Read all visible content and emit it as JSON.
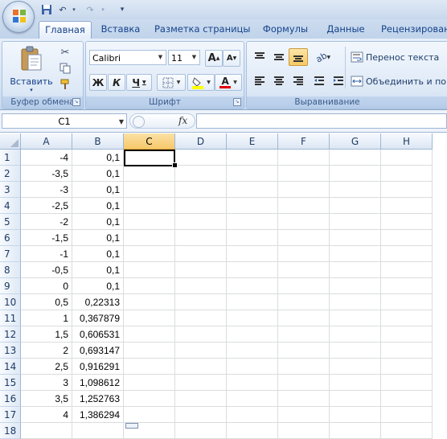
{
  "tabs": [
    "Главная",
    "Вставка",
    "Разметка страницы",
    "Формулы",
    "Данные",
    "Рецензирование"
  ],
  "active_tab": "Главная",
  "clipboard": {
    "paste_label": "Вставить",
    "group_label": "Буфер обмена"
  },
  "font": {
    "family": "Calibri",
    "size": "11",
    "group_label": "Шрифт",
    "bold": "Ж",
    "italic": "К",
    "underline": "Ч",
    "grow": "A",
    "shrink": "A",
    "font_color_glyph": "A"
  },
  "alignment": {
    "wrap_text": "Перенос текста",
    "merge_center": "Объединить и пом",
    "group_label": "Выравнивание"
  },
  "formula_bar": {
    "name_box": "C1",
    "fx": "fx",
    "formula": ""
  },
  "columns": [
    "A",
    "B",
    "C",
    "D",
    "E",
    "F",
    "G",
    "H"
  ],
  "selected_column": "C",
  "rows": [
    {
      "n": "1",
      "a": "-4",
      "b": "0,1"
    },
    {
      "n": "2",
      "a": "-3,5",
      "b": "0,1"
    },
    {
      "n": "3",
      "a": "-3",
      "b": "0,1"
    },
    {
      "n": "4",
      "a": "-2,5",
      "b": "0,1"
    },
    {
      "n": "5",
      "a": "-2",
      "b": "0,1"
    },
    {
      "n": "6",
      "a": "-1,5",
      "b": "0,1"
    },
    {
      "n": "7",
      "a": "-1",
      "b": "0,1"
    },
    {
      "n": "8",
      "a": "-0,5",
      "b": "0,1"
    },
    {
      "n": "9",
      "a": "0",
      "b": "0,1"
    },
    {
      "n": "10",
      "a": "0,5",
      "b": "0,22313"
    },
    {
      "n": "11",
      "a": "1",
      "b": "0,367879"
    },
    {
      "n": "12",
      "a": "1,5",
      "b": "0,606531"
    },
    {
      "n": "13",
      "a": "2",
      "b": "0,693147"
    },
    {
      "n": "14",
      "a": "2,5",
      "b": "0,916291"
    },
    {
      "n": "15",
      "a": "3",
      "b": "1,098612"
    },
    {
      "n": "16",
      "a": "3,5",
      "b": "1,252763"
    },
    {
      "n": "17",
      "a": "4",
      "b": "1,386294"
    },
    {
      "n": "18",
      "a": "",
      "b": ""
    }
  ],
  "colors": {
    "ribbon": "#dde8f6",
    "header_selected": "#f6c869",
    "accent": "#15428b",
    "font_red": "#e00000",
    "highlight_yellow": "#ffff00"
  }
}
